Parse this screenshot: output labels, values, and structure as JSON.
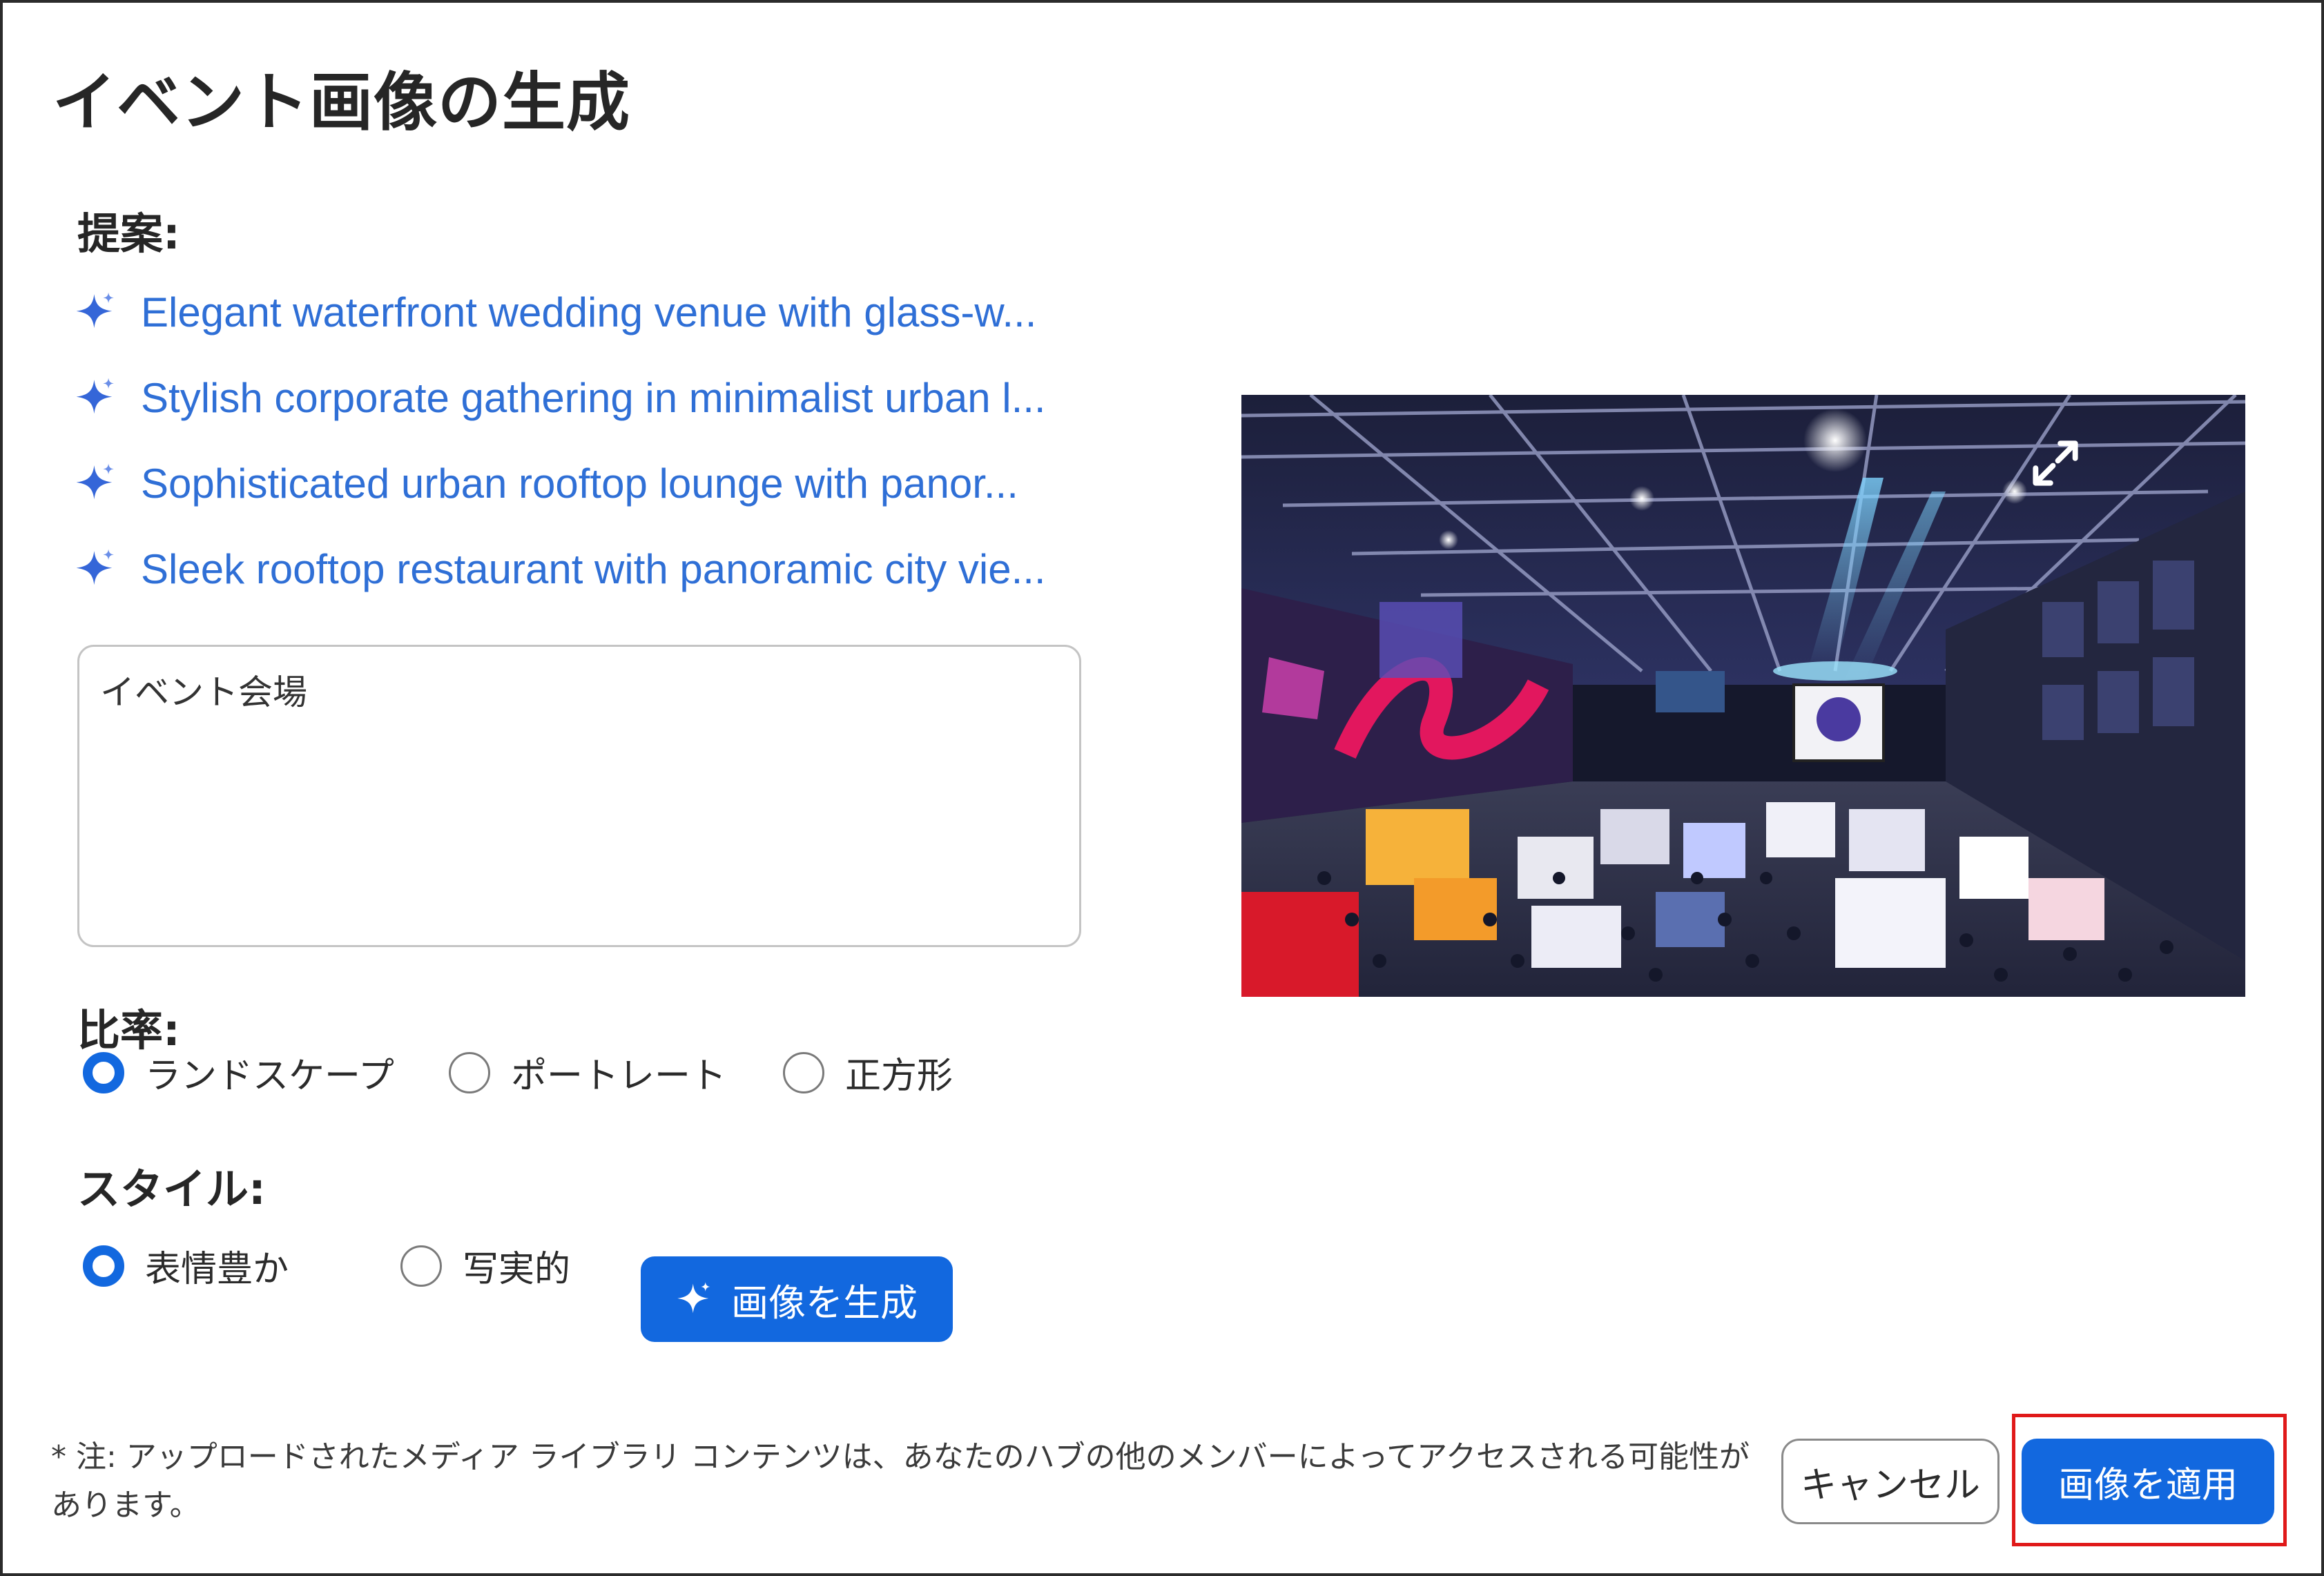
{
  "dialog": {
    "title": "イベント画像の生成"
  },
  "suggestions": {
    "label": "提案:",
    "items": [
      "Elegant waterfront wedding venue with glass-w...",
      "Stylish corporate gathering in minimalist urban l...",
      "Sophisticated urban rooftop lounge with panor...",
      "Sleek rooftop restaurant with panoramic city vie..."
    ]
  },
  "prompt": {
    "value": "イベント会場"
  },
  "ratio": {
    "label": "比率:",
    "options": [
      "ランドスケープ",
      "ポートレート",
      "正方形"
    ],
    "selected": "ランドスケープ"
  },
  "style": {
    "label": "スタイル:",
    "options": [
      "表情豊か",
      "写実的"
    ],
    "selected": "表情豊か"
  },
  "generate_button": {
    "label": "画像を生成",
    "icon": "sparkle-icon"
  },
  "preview": {
    "expand_icon": "expand-icon"
  },
  "footer": {
    "note": "* 注: アップロードされたメディア ライブラリ コンテンツは、あなたのハブの他のメンバーによってアクセスされる可能性があります。",
    "cancel_label": "キャンセル",
    "apply_label": "画像を適用"
  },
  "colors": {
    "accent": "#1268df",
    "link": "#2f6fd6",
    "highlight": "#e01919"
  }
}
